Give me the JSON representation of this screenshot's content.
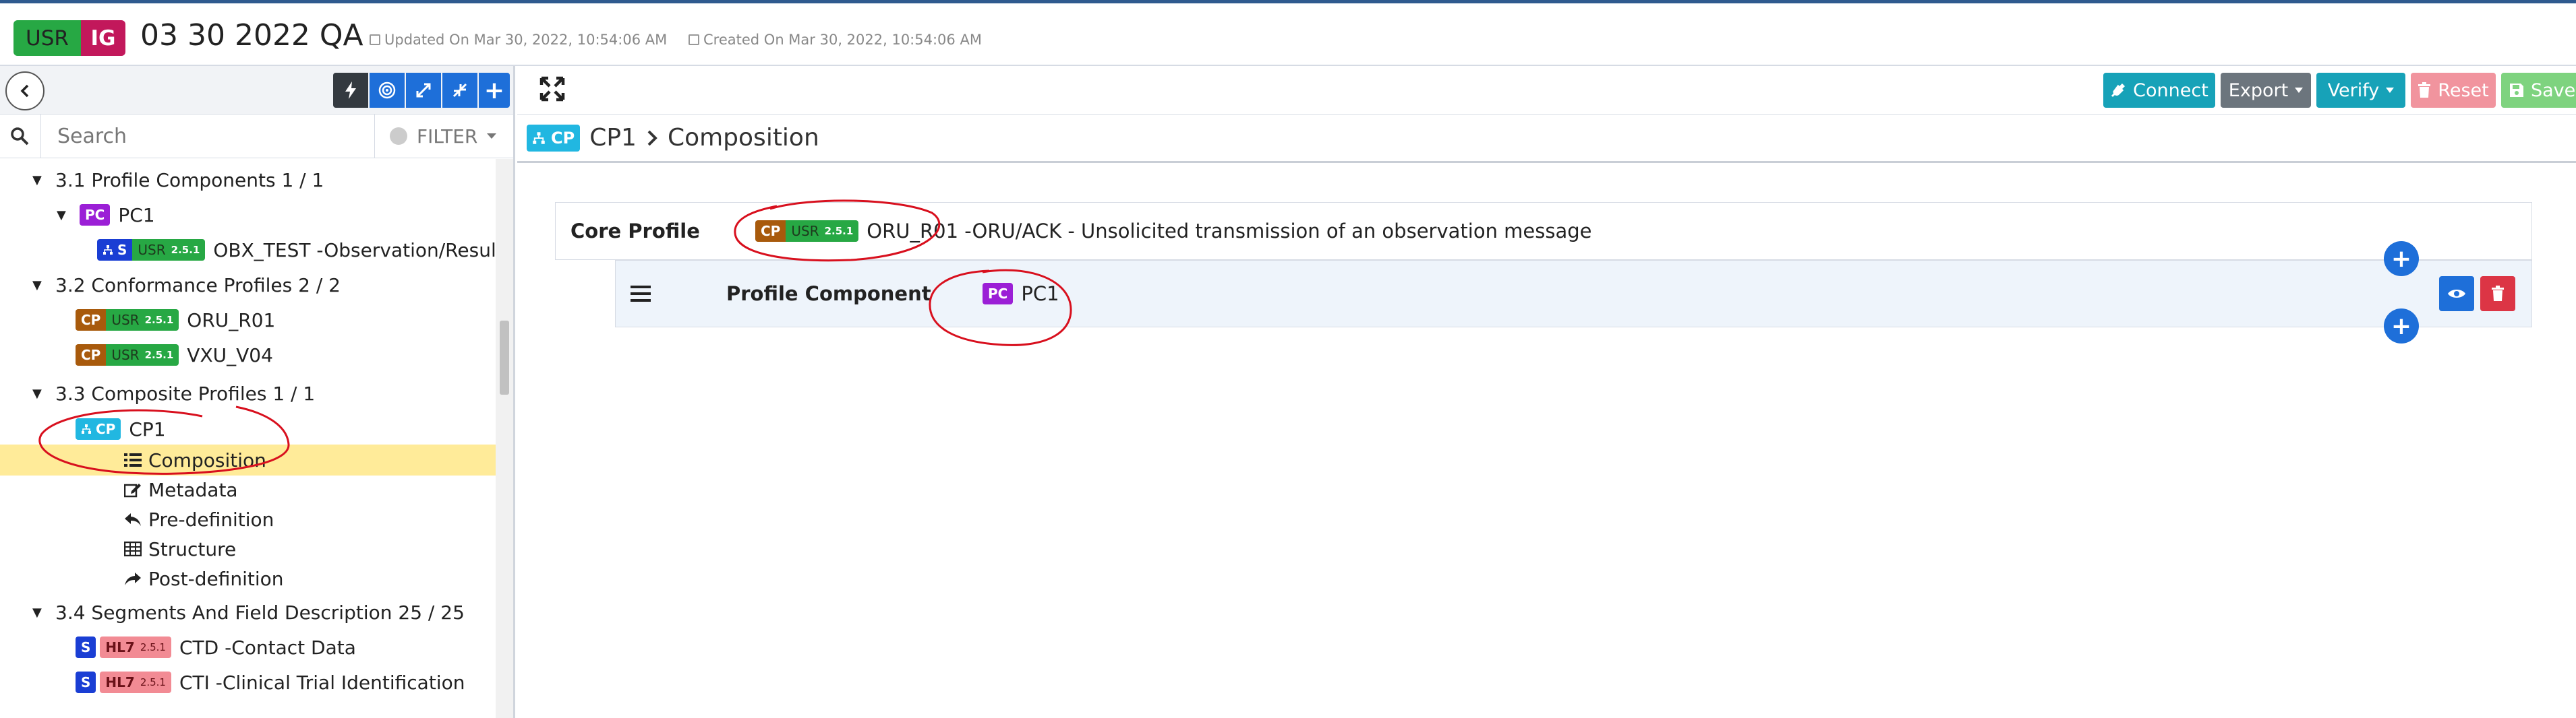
{
  "header": {
    "usr_badge": "USR",
    "ig_badge": "IG",
    "title": "03 30 2022 QA",
    "updated": "Updated On Mar 30, 2022, 10:54:06 AM",
    "created": "Created On Mar 30, 2022, 10:54:06 AM"
  },
  "sidebar": {
    "search_placeholder": "Search",
    "filter_label": "FILTER",
    "tree": {
      "sec31": "3.1 Profile Components 1 / 1",
      "pc1_badge": "PC",
      "pc1_label": "PC1",
      "obx_badge_s": "S",
      "obx_badge_usr": "USR",
      "obx_badge_ver": "2.5.1",
      "obx_label": "OBX_TEST -Observation/Result",
      "sec32": "3.2 Conformance Profiles 2 / 2",
      "oru_badge_cp": "CP",
      "oru_badge_usr": "USR",
      "oru_badge_ver": "2.5.1",
      "oru_label": "ORU_R01",
      "vxu_badge_cp": "CP",
      "vxu_badge_usr": "USR",
      "vxu_badge_ver": "2.5.1",
      "vxu_label": "VXU_V04",
      "sec33": "3.3 Composite Profiles 1 / 1",
      "cp1_badge": "CP",
      "cp1_label": "CP1",
      "composition": "Composition",
      "metadata": "Metadata",
      "predefinition": "Pre-definition",
      "structure": "Structure",
      "postdefinition": "Post-definition",
      "sec34": "3.4 Segments And Field Description 25 / 25",
      "ctd_badge_s": "S",
      "ctd_badge_hl7": "HL7",
      "ctd_badge_ver": "2.5.1",
      "ctd_label": "CTD -Contact Data",
      "cti_badge_s": "S",
      "cti_badge_hl7": "HL7",
      "cti_badge_ver": "2.5.1",
      "cti_label": "CTI -Clinical Trial Identification"
    }
  },
  "toolbar": {
    "connect": "Connect",
    "export": "Export",
    "verify": "Verify",
    "reset": "Reset",
    "save": "Save"
  },
  "breadcrumb": {
    "badge": "CP",
    "profile": "CP1",
    "section": "Composition"
  },
  "composition": {
    "core_label": "Core Profile",
    "core_badge_cp": "CP",
    "core_badge_usr": "USR",
    "core_badge_ver": "2.5.1",
    "core_desc": "ORU_R01 -ORU/ACK - Unsolicited transmission of an observation message",
    "component_label": "Profile Component",
    "component_badge": "PC",
    "component_name": "PC1"
  },
  "colors": {
    "accent_blue": "#1e6fd9",
    "connect": "#17a2b8",
    "export": "#6c757d",
    "verify": "#17a2b8",
    "reset": "#f1949e",
    "save": "#7ed37f",
    "selected": "#ffeb99",
    "annotation": "#d8101e"
  }
}
